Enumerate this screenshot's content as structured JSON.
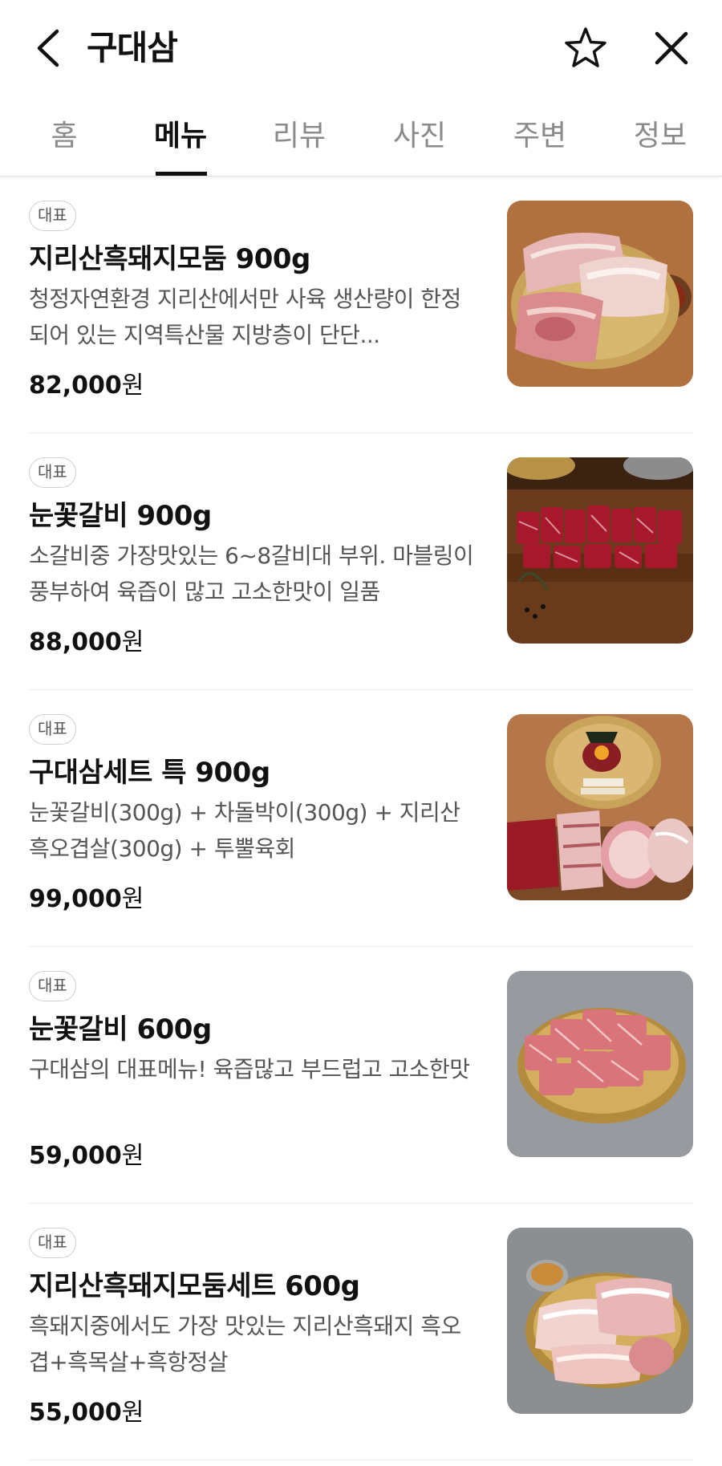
{
  "header": {
    "title": "구대삼"
  },
  "tabs": [
    {
      "label": "홈"
    },
    {
      "label": "메뉴"
    },
    {
      "label": "리뷰"
    },
    {
      "label": "사진"
    },
    {
      "label": "주변"
    },
    {
      "label": "정보"
    }
  ],
  "active_tab": "메뉴",
  "menu": [
    {
      "badge": "대표",
      "name": "지리산흑돼지모둠 900g",
      "desc": "청정자연환경 지리산에서만 사육 생산량이 한정되어 있는 지역특산물 지방층이 단단...",
      "price": "82,000",
      "currency": "원"
    },
    {
      "badge": "대표",
      "name": "눈꽃갈비 900g",
      "desc": "소갈비중 가장맛있는 6~8갈비대 부위. 마블링이 풍부하여 육즙이 많고 고소한맛이 일품",
      "price": "88,000",
      "currency": "원"
    },
    {
      "badge": "대표",
      "name": "구대삼세트 특 900g",
      "desc": "눈꽃갈비(300g) + 차돌박이(300g) + 지리산흑오겹살(300g) + 투뿔육회",
      "price": "99,000",
      "currency": "원"
    },
    {
      "badge": "대표",
      "name": "눈꽃갈비 600g",
      "desc": "구대삼의 대표메뉴! 육즙많고 부드럽고 고소한맛",
      "price": "59,000",
      "currency": "원"
    },
    {
      "badge": "대표",
      "name": "지리산흑돼지모둠세트 600g",
      "desc": "흑돼지중에서도 가장 맛있는 지리산흑돼지 흑오겹+흑목살+흑항정살",
      "price": "55,000",
      "currency": "원"
    }
  ],
  "colors": {
    "active_tab": "#111111",
    "inactive_tab": "#8a8a8a",
    "desc_text": "#555555"
  }
}
